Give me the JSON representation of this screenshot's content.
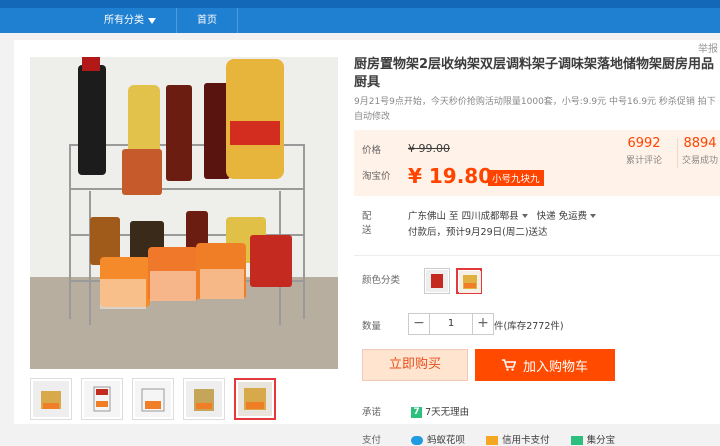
{
  "nav": {
    "category_label": "所有分类",
    "home_label": "首页"
  },
  "report_label": "举报",
  "product": {
    "title_line1": "厨房置物架2层收纳架双层调料架子调味架落地储物架厨房用品",
    "title_line2": "厨具",
    "promo_line1": "9月21号9点开始，今天秒价抢购活动限量1000套，小号:9.9元 中号16.9元 秒杀促销 拍下",
    "promo_line2": "自动修改"
  },
  "price": {
    "price_label": "价格",
    "old_price": "¥ 99.00",
    "taobao_label": "淘宝价",
    "current_price": "¥ 19.80",
    "badge": "小号九块九",
    "reviews_count": "6992",
    "reviews_label": "累计评论",
    "sales_count": "8894",
    "sales_label": "交易成功"
  },
  "delivery": {
    "label": "配送",
    "from": "广东佛山",
    "to_word": "至",
    "destination": "四川成都郫县",
    "express": "快递 免运费",
    "note": "付款后，预计9月29日(周二)送达"
  },
  "color": {
    "label": "颜色分类"
  },
  "quantity": {
    "label": "数量",
    "minus": "−",
    "value": "1",
    "plus": "+",
    "stock": "件(库存2772件)"
  },
  "actions": {
    "buy_now": "立即购买",
    "add_to_cart": "加入购物车"
  },
  "promise": {
    "label": "承诺",
    "seven_icon": "7",
    "text": "7天无理由"
  },
  "payment": {
    "label": "支付",
    "method1": "蚂蚁花呗",
    "method2": "信用卡支付",
    "method3": "集分宝"
  },
  "colors": {
    "accent": "#ff4a00",
    "price": "#ff4400",
    "nav": "#1f7fd0"
  }
}
